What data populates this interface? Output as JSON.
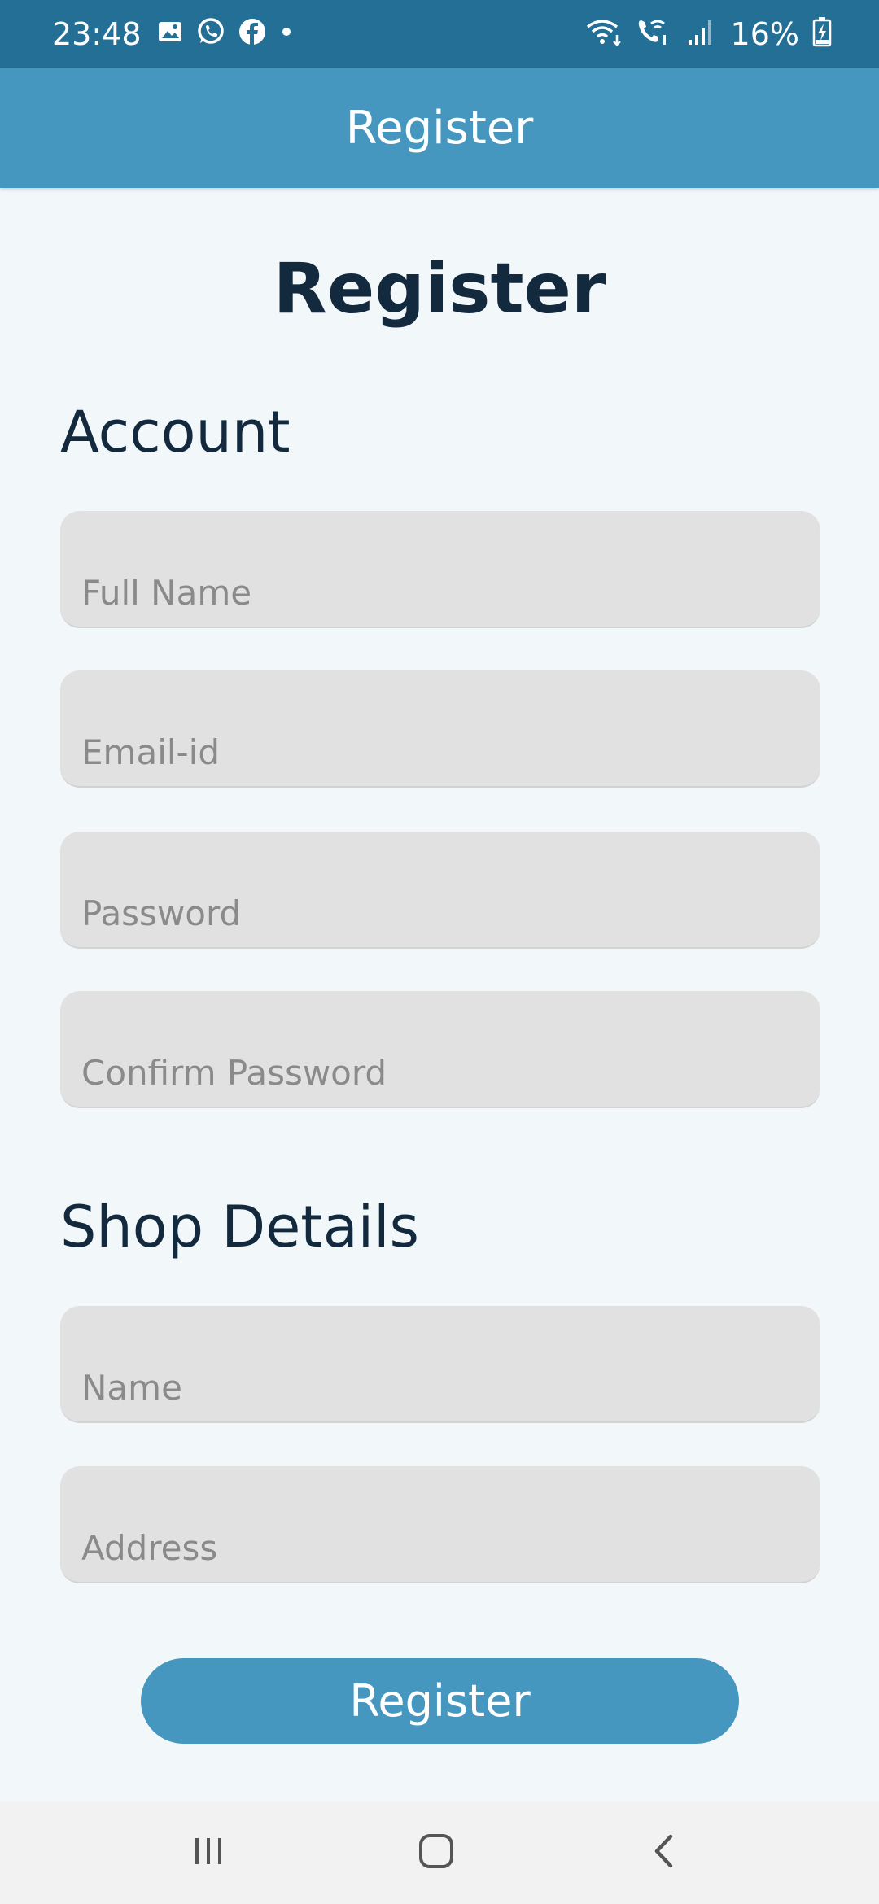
{
  "status_bar": {
    "time": "23:48",
    "notification_icons": [
      "gallery-icon",
      "whatsapp-icon",
      "facebook-icon",
      "dot-icon"
    ],
    "right_icons": [
      "wifi-icon",
      "wifi-calling-icon",
      "signal-icon"
    ],
    "battery_percent": "16%",
    "colors": {
      "background": "#246f96"
    }
  },
  "app_bar": {
    "title": "Register",
    "color": "#4697c0"
  },
  "page": {
    "heading": "Register"
  },
  "account_section": {
    "title": "Account",
    "fields": {
      "full_name": {
        "placeholder": "Full Name",
        "value": ""
      },
      "email": {
        "placeholder": "Email-id",
        "value": ""
      },
      "password": {
        "placeholder": "Password",
        "value": ""
      },
      "confirm_password": {
        "placeholder": "Confirm Password",
        "value": ""
      }
    }
  },
  "shop_section": {
    "title": "Shop Details",
    "fields": {
      "name": {
        "placeholder": "Name",
        "value": ""
      },
      "address": {
        "placeholder": "Address",
        "value": ""
      }
    }
  },
  "register_button": {
    "label": "Register",
    "color": "#4697c0"
  },
  "nav_bar": {
    "buttons": [
      "recents-icon",
      "home-icon",
      "back-icon"
    ]
  }
}
